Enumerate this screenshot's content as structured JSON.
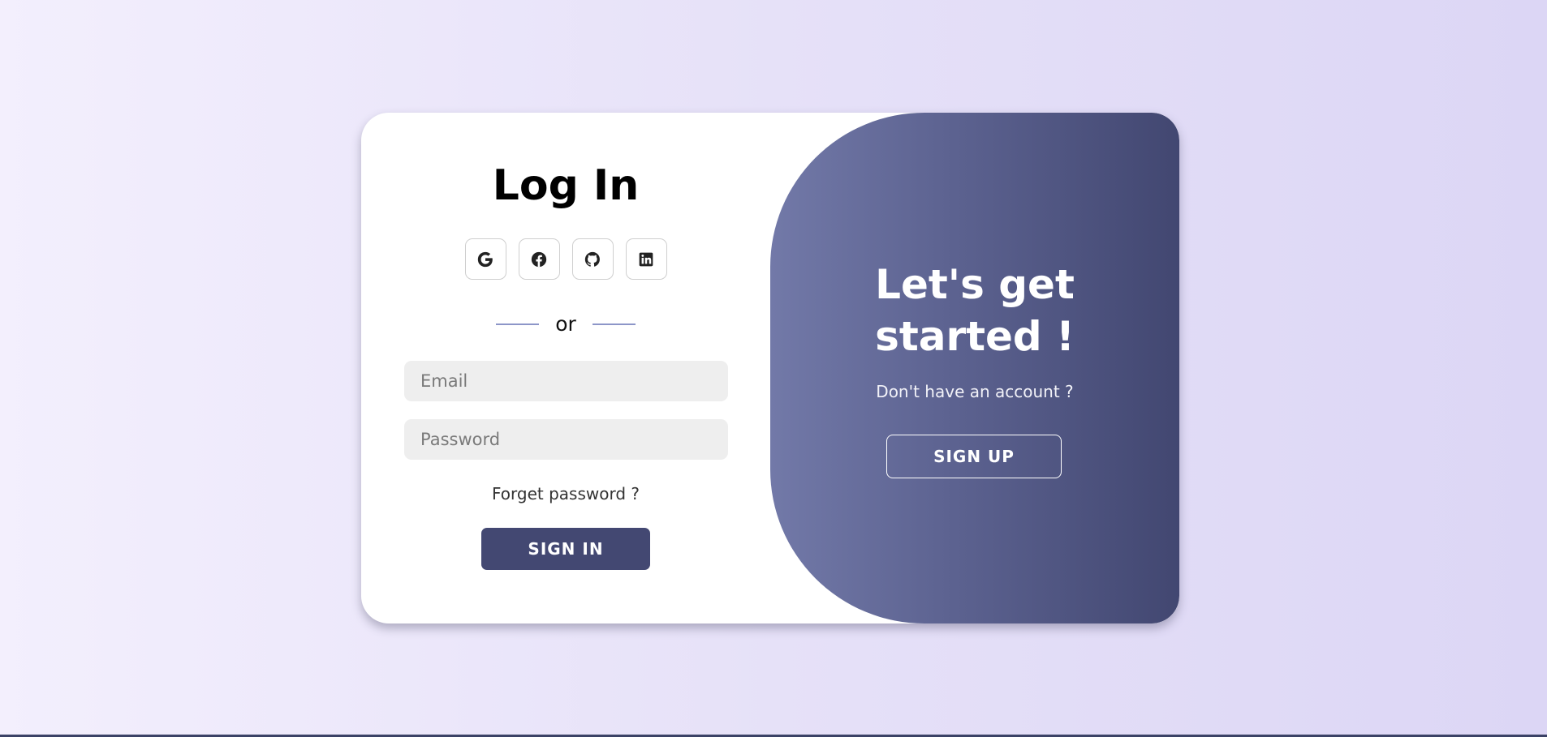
{
  "login": {
    "title": "Log In",
    "social": [
      {
        "name": "google",
        "icon": "google-icon"
      },
      {
        "name": "facebook",
        "icon": "facebook-icon"
      },
      {
        "name": "github",
        "icon": "github-icon"
      },
      {
        "name": "linkedin",
        "icon": "linkedin-icon"
      }
    ],
    "divider_text": "or",
    "email_placeholder": "Email",
    "password_placeholder": "Password",
    "forgot_label": "Forget password ?",
    "signin_label": "SIGN IN"
  },
  "signup": {
    "title": "Let's get started !",
    "subtitle": "Don't have an account ?",
    "button_label": "SIGN UP"
  },
  "colors": {
    "accent": "#434872",
    "panel_gradient_start": "#7279a8",
    "panel_gradient_end": "#424771",
    "divider": "#8d96c8"
  }
}
